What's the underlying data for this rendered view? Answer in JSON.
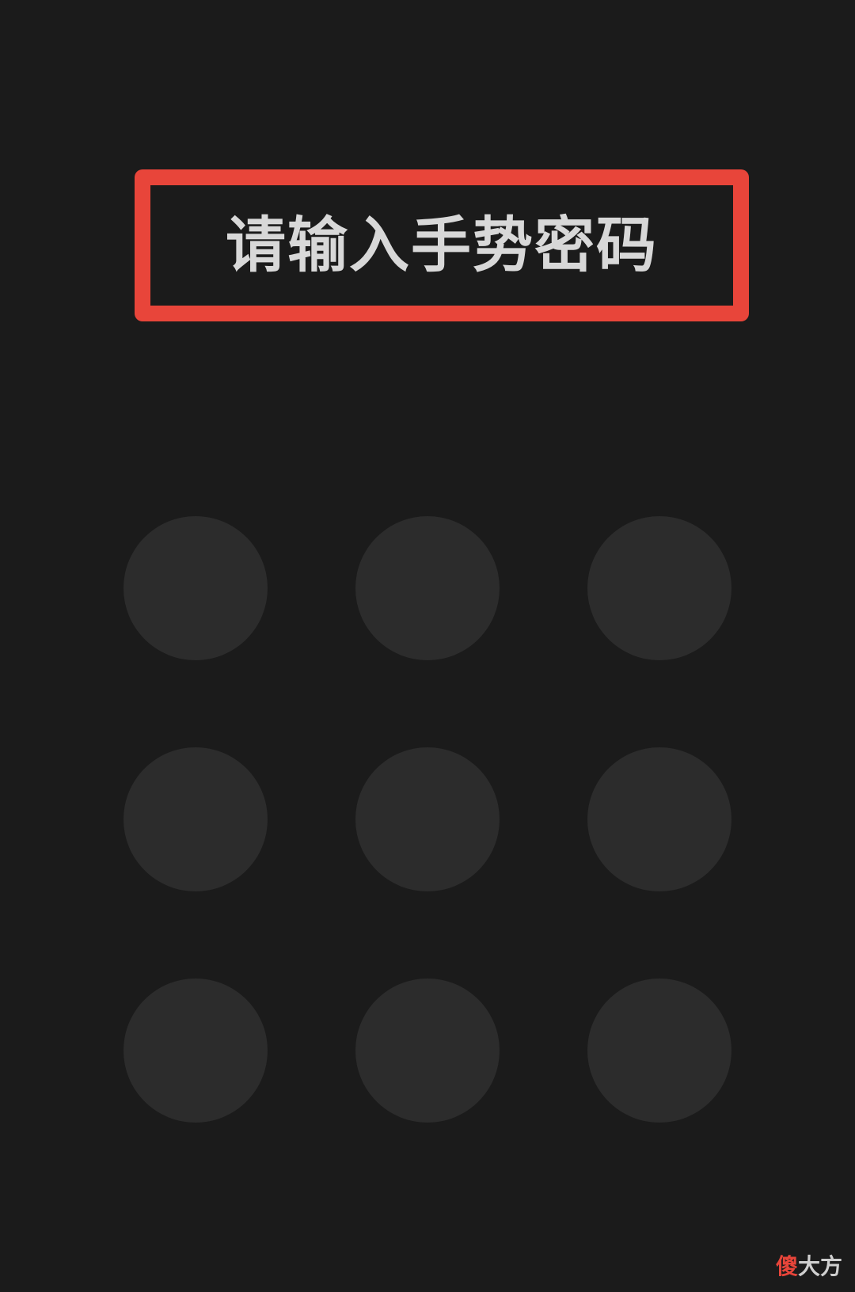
{
  "prompt": {
    "text": "请输入手势密码"
  },
  "pattern": {
    "dots": [
      {
        "id": "1"
      },
      {
        "id": "2"
      },
      {
        "id": "3"
      },
      {
        "id": "4"
      },
      {
        "id": "5"
      },
      {
        "id": "6"
      },
      {
        "id": "7"
      },
      {
        "id": "8"
      },
      {
        "id": "9"
      }
    ]
  },
  "watermark": {
    "part1": "傻",
    "part2": "大方"
  },
  "colors": {
    "background": "#1b1b1b",
    "highlight_border": "#e8453a",
    "dot": "#2c2c2c",
    "text": "#d8d8d8"
  }
}
